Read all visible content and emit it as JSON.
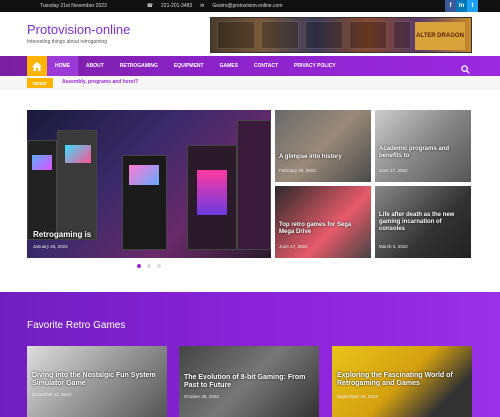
{
  "topbar": {
    "date": "Tuesday 21st November 2023",
    "phone": "221-201-3483",
    "email": "Gestro@protovision-online.com",
    "social": [
      "f",
      "in",
      "t"
    ]
  },
  "header": {
    "site_title": "Protovision-online",
    "tagline": "Interesting things about retrogaming",
    "ad_logo": "ALTER DRAGON"
  },
  "nav": {
    "items": [
      "HOME",
      "ABOUT",
      "RETROGAMING",
      "EQUIPMENT",
      "GAMES",
      "CONTACT",
      "PRIVACY POLICY"
    ],
    "search_icon": "search-icon",
    "home_icon": "home-icon"
  },
  "ticker": {
    "label": "NEWS",
    "text": "Assembly, programs and heroi?"
  },
  "featured": {
    "main": {
      "title": "Retrogaming is",
      "date": "January 26, 2022"
    },
    "side": [
      {
        "title": "A glimpse into history",
        "date": "February 20, 2022"
      },
      {
        "title": "Academic programs and benefits to",
        "date": "June 17, 2022"
      },
      {
        "title": "Top retro games for Sega Mega Drive",
        "date": "June 17, 2022"
      },
      {
        "title": "Life after death as the new gaming incarnation of consoles",
        "date": "March 3, 2022"
      }
    ]
  },
  "favorites": {
    "title": "Favorite Retro Games",
    "cards": [
      {
        "title": "Diving into the Nostalgic Fun System Simulator Game",
        "date": "December 11, 2023"
      },
      {
        "title": "The Evolution of 8-bit Gaming: From Past to Future",
        "date": "October 30, 2023"
      },
      {
        "title": "Exploring the Fascinating World of Retrogaming and Games",
        "date": "September 28, 2023"
      }
    ]
  },
  "colors": {
    "brand": "#8b22c8",
    "accent": "#ffb400"
  }
}
